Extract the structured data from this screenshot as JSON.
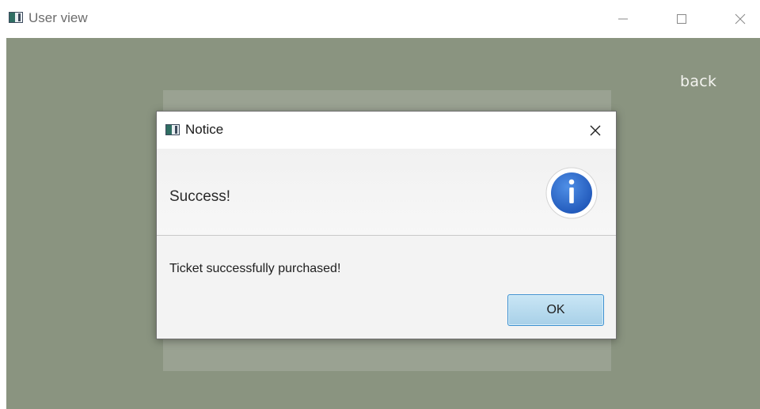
{
  "window": {
    "title": "User view",
    "icon": "app-window-icon"
  },
  "app": {
    "back_label": "back",
    "background_color": "#8a9480"
  },
  "dialog": {
    "title": "Notice",
    "header_text": "Success!",
    "content_text": "Ticket successfully purchased!",
    "ok_label": "OK",
    "icon": "info-icon",
    "accent_color": "#2f6fd0"
  }
}
